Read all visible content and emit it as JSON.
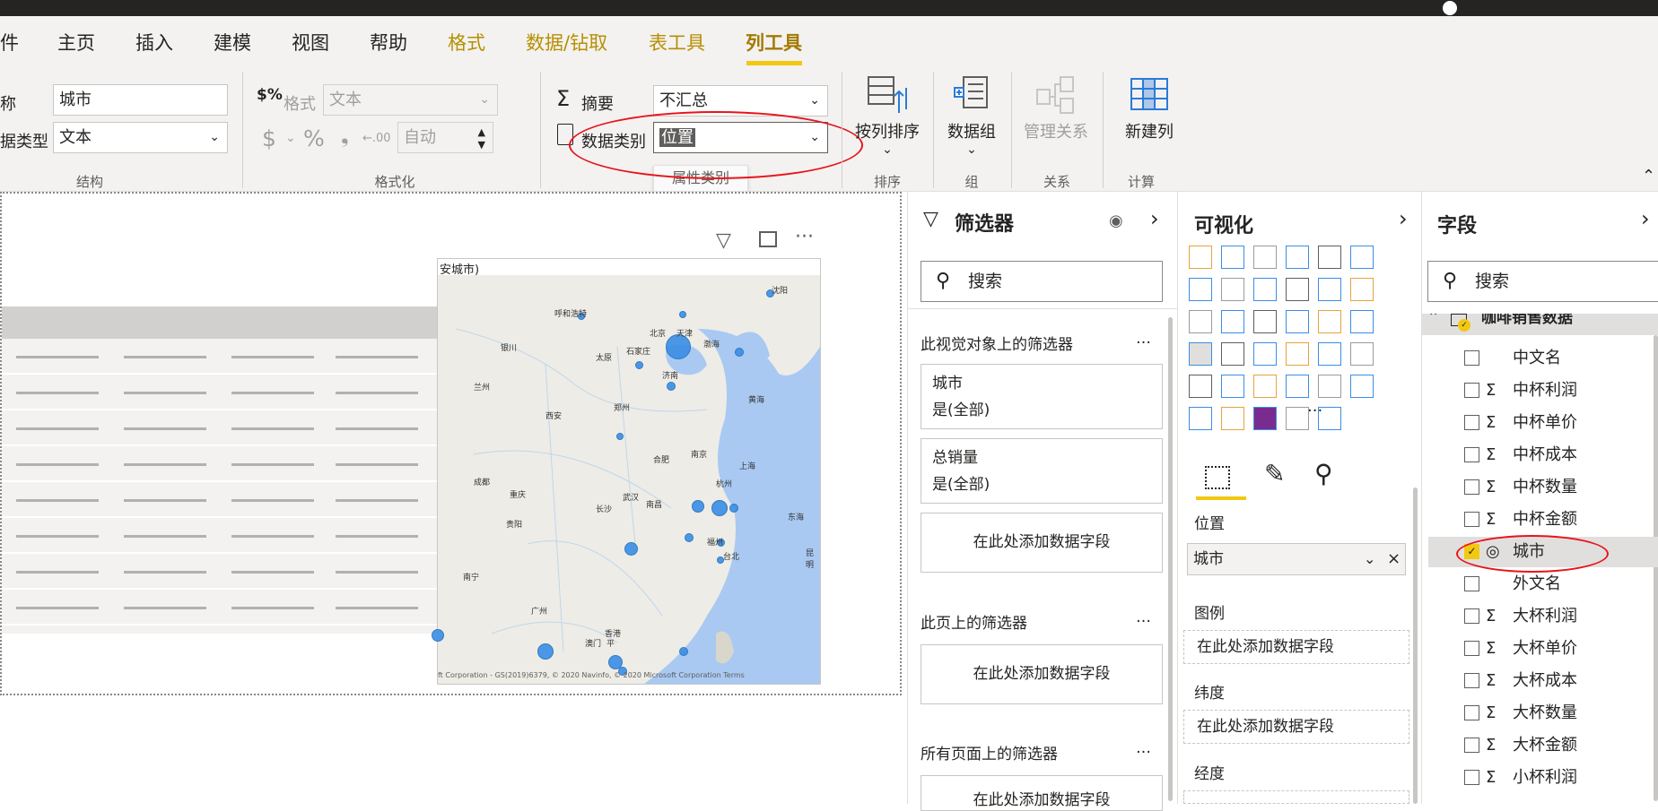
{
  "tabs": [
    {
      "label": "件",
      "kind": "normal"
    },
    {
      "label": "主页",
      "kind": "normal"
    },
    {
      "label": "插入",
      "kind": "normal"
    },
    {
      "label": "建模",
      "kind": "normal"
    },
    {
      "label": "视图",
      "kind": "normal"
    },
    {
      "label": "帮助",
      "kind": "normal"
    },
    {
      "label": "格式",
      "kind": "contextual"
    },
    {
      "label": "数据/钻取",
      "kind": "contextual"
    },
    {
      "label": "表工具",
      "kind": "contextual"
    },
    {
      "label": "列工具",
      "kind": "active"
    }
  ],
  "ribbon": {
    "structure": {
      "name_label": "称",
      "name_value": "城市",
      "datatype_label": "据类型",
      "datatype_value": "文本",
      "group_label": "结构"
    },
    "formatting": {
      "format_label": "格式",
      "format_value": "文本",
      "currency_symbol": "$",
      "percent_symbol": "%",
      "comma_symbol": "❟",
      "decimal_symbol": "←.00",
      "auto_value": "自动",
      "group_label": "格式化"
    },
    "properties": {
      "summary_label": "摘要",
      "summary_value": "不汇总",
      "category_label": "数据类别",
      "category_value": "位置",
      "tooltip": "属性类别"
    },
    "sort": {
      "label": "按列排序",
      "group_label": "排序"
    },
    "groups": {
      "label": "数据组",
      "group_label": "组"
    },
    "relations": {
      "label": "管理关系",
      "group_label": "关系"
    },
    "calc": {
      "label": "新建列",
      "group_label": "计算"
    }
  },
  "map": {
    "title": "安城市)",
    "attribution": "ft Corporation - GS(2019)6379, © 2020 Navinfo, © 2020 Microsoft Corporation  Terms",
    "cities": [
      "沈阳",
      "呼和浩特",
      "北京",
      "天津",
      "渤海",
      "银川",
      "太原",
      "石家庄",
      "济南",
      "兰州",
      "郑州",
      "西安",
      "黄海",
      "合肥",
      "南京",
      "上海",
      "武汉",
      "杭州",
      "东海",
      "成都",
      "重庆",
      "长沙",
      "南昌",
      "贵阳",
      "福州",
      "台北",
      "昆明",
      "南宁",
      "广州",
      "澳门",
      "香港",
      "平"
    ]
  },
  "filters": {
    "title": "筛选器",
    "search_placeholder": "搜索",
    "visual_section": "此视觉对象上的筛选器",
    "cards": [
      {
        "name": "城市",
        "value": "是(全部)"
      },
      {
        "name": "总销量",
        "value": "是(全部)"
      }
    ],
    "add_field": "在此处添加数据字段",
    "page_section": "此页上的筛选器",
    "all_section": "所有页面上的筛选器",
    "more": "…"
  },
  "viz": {
    "title": "可视化",
    "location_label": "位置",
    "location_value": "城市",
    "legend_label": "图例",
    "lat_label": "纬度",
    "lng_label": "经度",
    "add_field": "在此处添加数据字段",
    "more": "···"
  },
  "fields": {
    "title": "字段",
    "search_placeholder": "搜索",
    "table_name": "咖啡销售数据",
    "items": [
      {
        "name": "中文名",
        "type": "",
        "checked": false
      },
      {
        "name": "中杯利润",
        "type": "Σ",
        "checked": false
      },
      {
        "name": "中杯单价",
        "type": "Σ",
        "checked": false
      },
      {
        "name": "中杯成本",
        "type": "Σ",
        "checked": false
      },
      {
        "name": "中杯数量",
        "type": "Σ",
        "checked": false
      },
      {
        "name": "中杯金额",
        "type": "Σ",
        "checked": false
      },
      {
        "name": "城市",
        "type": "globe",
        "checked": true
      },
      {
        "name": "外文名",
        "type": "",
        "checked": false
      },
      {
        "name": "大杯利润",
        "type": "Σ",
        "checked": false
      },
      {
        "name": "大杯单价",
        "type": "Σ",
        "checked": false
      },
      {
        "name": "大杯成本",
        "type": "Σ",
        "checked": false
      },
      {
        "name": "大杯数量",
        "type": "Σ",
        "checked": false
      },
      {
        "name": "大杯金额",
        "type": "Σ",
        "checked": false
      },
      {
        "name": "小杯利润",
        "type": "Σ",
        "checked": false
      }
    ]
  },
  "colors": {
    "accent": "#f2c811",
    "annotation": "#e8141b",
    "contextual_tab": "#b78f00"
  }
}
